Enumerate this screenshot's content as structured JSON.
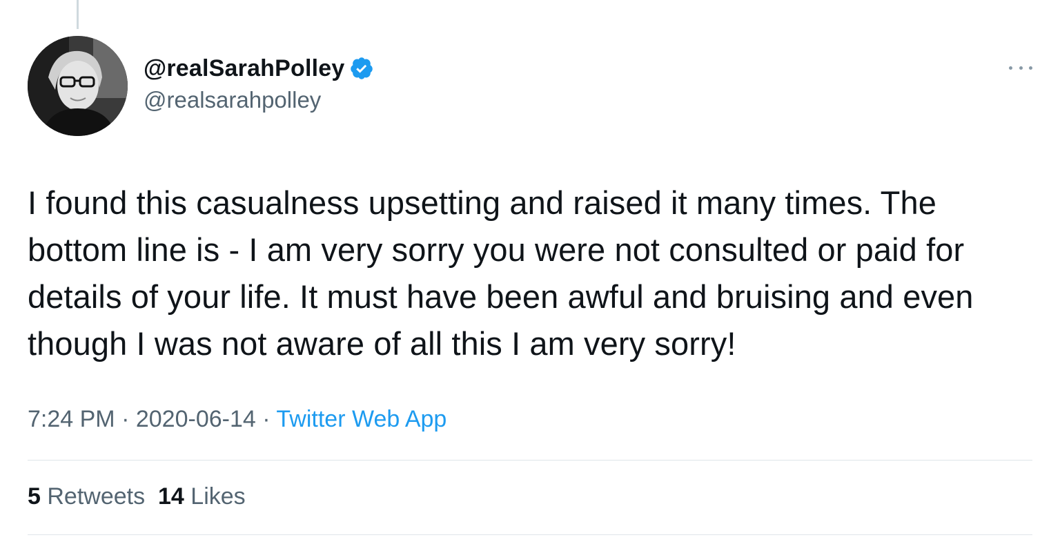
{
  "tweet": {
    "display_name": "@realSarahPolley",
    "handle": "@realsarahpolley",
    "verified_icon": "verified-badge-icon",
    "more_icon": "more-options-icon",
    "text": "I found this casualness upsetting and raised it many times. The bottom line is - I am very sorry you were not consulted or paid for details of your life. It must have been awful and bruising and even though I was not aware of all this I am very sorry!",
    "time": "7:24 PM",
    "separator": "·",
    "date": "2020-06-14",
    "source": "Twitter Web App",
    "retweets_count": "5",
    "retweets_label": "Retweets",
    "likes_count": "14",
    "likes_label": "Likes"
  },
  "colors": {
    "text_primary": "#0f1419",
    "text_secondary": "#536471",
    "link": "#1d9bf0",
    "verified": "#1d9bf0",
    "divider": "#dfe5e9"
  }
}
